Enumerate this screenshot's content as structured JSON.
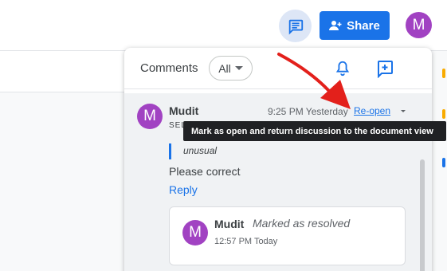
{
  "topbar": {
    "share_label": "Share",
    "account_initial": "M",
    "comments_icon": "comments-icon",
    "share_icon": "person-add-icon"
  },
  "panel": {
    "title": "Comments",
    "filter_value": "All",
    "notifications_icon": "bell-icon",
    "add_comment_icon": "add-comment-icon"
  },
  "thread": {
    "author_initial": "M",
    "author": "Mudit",
    "time": "9:25 PM Yesterday",
    "reopen_label": "Re-open",
    "selected_label": "SEL",
    "quoted_text": "unusual",
    "comment": "Please correct",
    "reply_label": "Reply"
  },
  "resolved": {
    "author_initial": "M",
    "author": "Mudit",
    "status": "Marked as resolved",
    "time": "12:57 PM Today"
  },
  "tooltip": {
    "text": "Mark as open and return discussion to the document view"
  },
  "colors": {
    "accent": "#1a73e8",
    "avatar": "#a142c2",
    "annotation_arrow": "#e3201b"
  }
}
